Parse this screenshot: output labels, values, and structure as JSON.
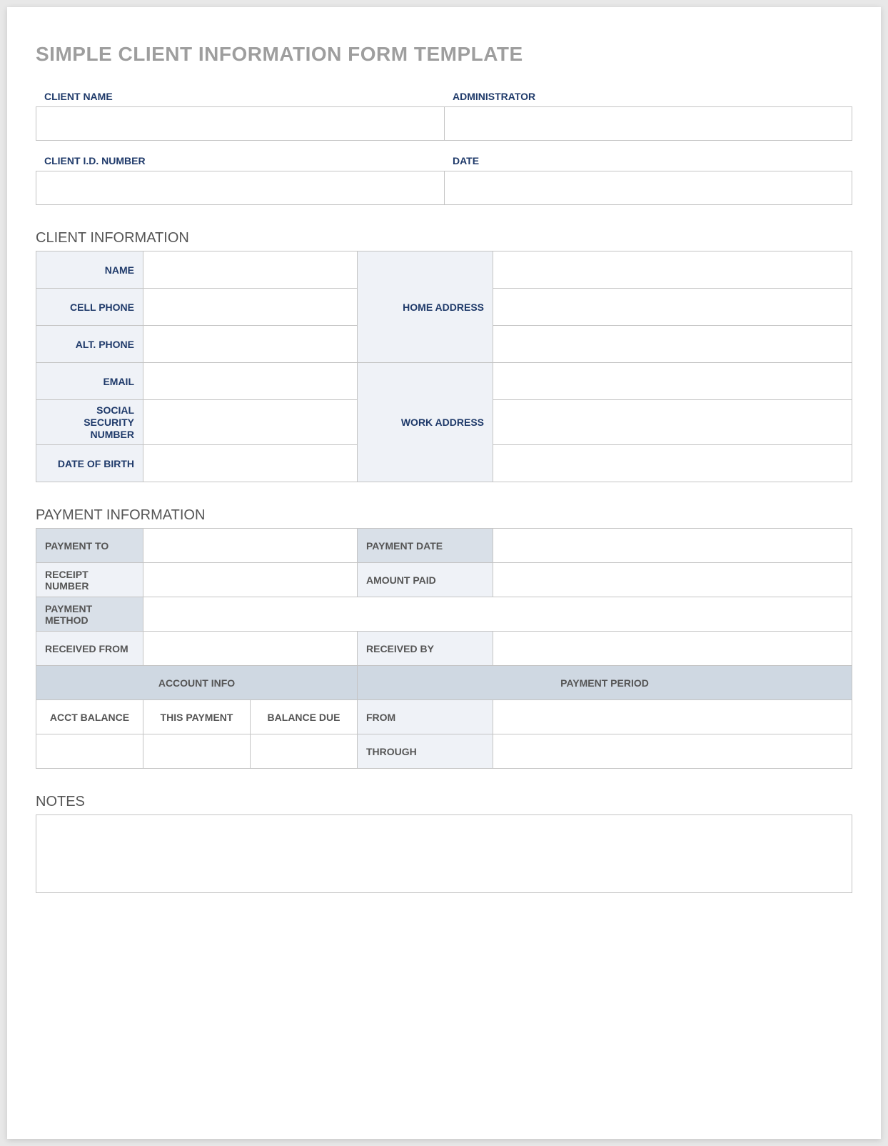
{
  "title": "SIMPLE CLIENT INFORMATION FORM TEMPLATE",
  "header": {
    "client_name_label": "CLIENT NAME",
    "client_name_value": "",
    "administrator_label": "ADMINISTRATOR",
    "administrator_value": "",
    "client_id_label": "CLIENT I.D. NUMBER",
    "client_id_value": "",
    "date_label": "DATE",
    "date_value": ""
  },
  "client_info": {
    "section_title": "CLIENT INFORMATION",
    "name_label": "NAME",
    "name_value": "",
    "cell_phone_label": "CELL PHONE",
    "cell_phone_value": "",
    "alt_phone_label": "ALT. PHONE",
    "alt_phone_value": "",
    "email_label": "EMAIL",
    "email_value": "",
    "ssn_label": "SOCIAL SECURITY NUMBER",
    "ssn_value": "",
    "dob_label": "DATE OF BIRTH",
    "dob_value": "",
    "home_address_label": "HOME ADDRESS",
    "home_address_line1": "",
    "home_address_line2": "",
    "home_address_line3": "",
    "work_address_label": "WORK ADDRESS",
    "work_address_line1": "",
    "work_address_line2": "",
    "work_address_line3": ""
  },
  "payment_info": {
    "section_title": "PAYMENT INFORMATION",
    "payment_to_label": "PAYMENT TO",
    "payment_to_value": "",
    "payment_date_label": "PAYMENT DATE",
    "payment_date_value": "",
    "receipt_number_label": "RECEIPT NUMBER",
    "receipt_number_value": "",
    "amount_paid_label": "AMOUNT PAID",
    "amount_paid_value": "",
    "payment_method_label": "PAYMENT METHOD",
    "payment_method_value": "",
    "received_from_label": "RECEIVED FROM",
    "received_from_value": "",
    "received_by_label": "RECEIVED BY",
    "received_by_value": "",
    "account_info_header": "ACCOUNT INFO",
    "payment_period_header": "PAYMENT PERIOD",
    "acct_balance_label": "ACCT BALANCE",
    "acct_balance_value": "",
    "this_payment_label": "THIS PAYMENT",
    "this_payment_value": "",
    "balance_due_label": "BALANCE DUE",
    "balance_due_value": "",
    "from_label": "FROM",
    "from_value": "",
    "through_label": "THROUGH",
    "through_value": ""
  },
  "notes": {
    "section_title": "NOTES",
    "value": ""
  }
}
